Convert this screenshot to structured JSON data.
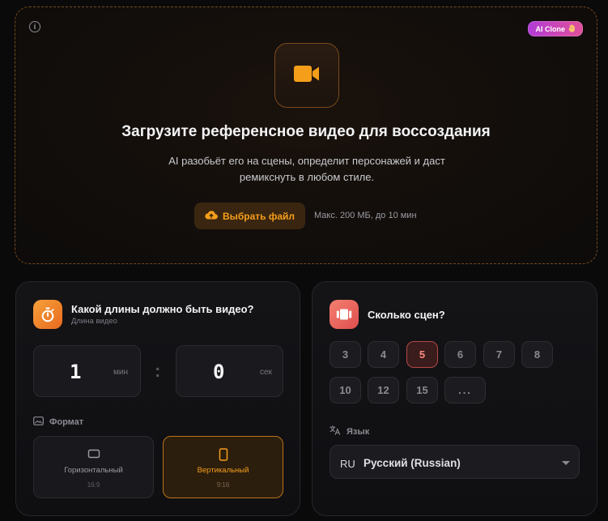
{
  "upload": {
    "info_symbol": "i",
    "badge_label": "AI Clone",
    "badge_icon": "hand-icon",
    "title": "Загрузите референсное видео для воссоздания",
    "description": "AI разобьёт его на сцены, определит персонажей и даст ремикснуть в любом стиле.",
    "button_label": "Выбрать файл",
    "limit_text": "Макс. 200 МБ, до 10 мин",
    "accent_color": "#f59e1a"
  },
  "duration": {
    "title": "Какой длины должно быть видео?",
    "subtitle": "Длина видео",
    "minutes_value": "1",
    "minutes_unit": "мин",
    "separator": ":",
    "seconds_value": "0",
    "seconds_unit": "сек",
    "format_label": "Формат",
    "formats": [
      {
        "name": "Горизонтальный",
        "ratio": "16:9",
        "selected": false
      },
      {
        "name": "Вертикальный",
        "ratio": "9:16",
        "selected": true
      }
    ]
  },
  "scenes": {
    "title": "Сколько сцен?",
    "options": [
      "3",
      "4",
      "5",
      "6",
      "7",
      "8",
      "10",
      "12",
      "15",
      "..."
    ],
    "selected": "5",
    "language_label": "Язык",
    "language_code": "RU",
    "language_name": "Русский (Russian)"
  }
}
